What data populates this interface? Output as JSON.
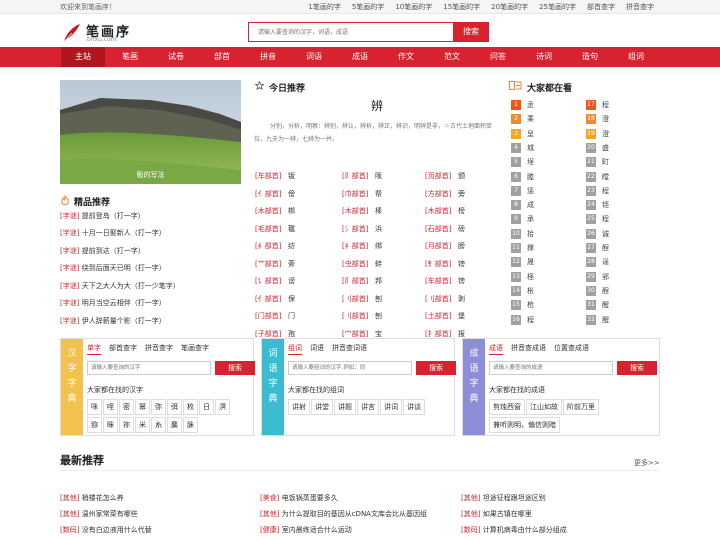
{
  "topbar": {
    "welcome": "欢迎来到笔画序！",
    "links": [
      "1笔画的字",
      "5笔画的字",
      "10笔画的字",
      "15笔画的字",
      "20笔画的字",
      "25笔画的字",
      "部首查字",
      "拼音查字"
    ]
  },
  "logo": {
    "name": "笔画序",
    "url": "bhxu.com"
  },
  "search": {
    "placeholder": "请输入要查询的汉字，词语，成语",
    "button": "搜索"
  },
  "nav": [
    "主站",
    "笔画",
    "试卷",
    "部首",
    "拼音",
    "词语",
    "成语",
    "作文",
    "范文",
    "问答",
    "诗词",
    "造句",
    "组词"
  ],
  "hero": {
    "caption": "彀的写法"
  },
  "picks": {
    "title": "精品推荐",
    "items": [
      {
        "tag": "[字谜]",
        "text": "提前登岛（打一字）"
      },
      {
        "tag": "[字谜]",
        "text": "十月一日娶新人（打一字）"
      },
      {
        "tag": "[字谜]",
        "text": "提前到达（打一字）"
      },
      {
        "tag": "[字谜]",
        "text": "绕到后面天已明（打一字）"
      },
      {
        "tag": "[字谜]",
        "text": "天下之大人为大（打一少笔字）"
      },
      {
        "tag": "[字谜]",
        "text": "明月当空云相伴（打一字）"
      },
      {
        "tag": "[字谜]",
        "text": "伊人辞薪量个影（打一字）"
      }
    ]
  },
  "today": {
    "title": "今日推荐",
    "word": "辨",
    "desc": "分别，分析，明察：辨别，辨认，辨析，辨正，辨识，明辨是非，＝古代土地面积单位，九夫为一辨，七辨为一并。"
  },
  "radicals": [
    [
      {
        "tag": "[车部首]",
        "ch": "钣"
      },
      {
        "tag": "[阝部首]",
        "ch": "阪"
      },
      {
        "tag": "[页部首]",
        "ch": "颁"
      }
    ],
    [
      {
        "tag": "[亻部首]",
        "ch": "傍"
      },
      {
        "tag": "[巾部首]",
        "ch": "帮"
      },
      {
        "tag": "[方部首]",
        "ch": "旁"
      }
    ],
    [
      {
        "tag": "[木部首]",
        "ch": "梆"
      },
      {
        "tag": "[木部首]",
        "ch": "棒"
      },
      {
        "tag": "[木部首]",
        "ch": "榜"
      }
    ],
    [
      {
        "tag": "[毛部首]",
        "ch": "毽"
      },
      {
        "tag": "[氵部首]",
        "ch": "浜"
      },
      {
        "tag": "[石部首]",
        "ch": "磅"
      }
    ],
    [
      {
        "tag": "[纟部首]",
        "ch": "纺"
      },
      {
        "tag": "[纟部首]",
        "ch": "绑"
      },
      {
        "tag": "[月部首]",
        "ch": "膀"
      }
    ],
    [
      {
        "tag": "[艹部首]",
        "ch": "蒡"
      },
      {
        "tag": "[虫部首]",
        "ch": "蚌"
      },
      {
        "tag": "[钅部首]",
        "ch": "镑"
      }
    ],
    [
      {
        "tag": "[讠部首]",
        "ch": "谤"
      },
      {
        "tag": "[阝部首]",
        "ch": "邦"
      },
      {
        "tag": "[车部首]",
        "ch": "镑"
      }
    ],
    [
      {
        "tag": "[亻部首]",
        "ch": "保"
      },
      {
        "tag": "[刂部首]",
        "ch": "刨"
      },
      {
        "tag": "[刂部首]",
        "ch": "剥"
      }
    ],
    [
      {
        "tag": "[门部首]",
        "ch": "门"
      },
      {
        "tag": "[刂部首]",
        "ch": "刨"
      },
      {
        "tag": "[土部首]",
        "ch": "堡"
      }
    ],
    [
      {
        "tag": "[子部首]",
        "ch": "孢"
      },
      {
        "tag": "[宀部首]",
        "ch": "宝"
      },
      {
        "tag": "[扌部首]",
        "ch": "报"
      }
    ]
  ],
  "hot": {
    "title": "大家都在看",
    "left": [
      "丞",
      "乘",
      "呈",
      "城",
      "埕",
      "塍",
      "惩",
      "成",
      "承",
      "拾",
      "撑",
      "晟",
      "柽",
      "枨",
      "枪",
      "程"
    ],
    "right": [
      "程",
      "澄",
      "澄",
      "盛",
      "町",
      "瞠",
      "程",
      "铚",
      "程",
      "诚",
      "酲",
      "逞",
      "郢",
      "酲",
      "醒",
      "醒"
    ],
    "colors": {
      "top1": "#e85a1c",
      "top2": "#f08a2c",
      "top3": "#f5a623",
      "rest": "#a0a0a0"
    }
  },
  "cards": [
    {
      "side": [
        "汉",
        "字",
        "字",
        "典"
      ],
      "color": "#f2c14e",
      "tabs": [
        "单字",
        "部首查字",
        "拼音查字",
        "笔画查字"
      ],
      "placeholder": "请输入要查询的汉字",
      "button": "搜索",
      "sub": "大家都在找的汉字",
      "chips": [
        "咪",
        "咥",
        "密",
        "幂",
        "弥",
        "弭",
        "枚",
        "日",
        "溟",
        "猕",
        "眯",
        "祢",
        "米",
        "糸",
        "麋",
        "脒"
      ]
    },
    {
      "side": [
        "词",
        "语",
        "字",
        "典"
      ],
      "color": "#3bbcd1",
      "tabs": [
        "组词",
        "词语",
        "拼音查词语"
      ],
      "placeholder": "请输入要组词的汉字,例如：同",
      "button": "搜索",
      "sub": "大家都在找的组词",
      "chips": [
        "讲射",
        "讲堂",
        "讲题",
        "讲言",
        "讲词",
        "讲谈"
      ]
    },
    {
      "side": [
        "成",
        "语",
        "字",
        "典"
      ],
      "color": "#8e8ed8",
      "tabs": [
        "成语",
        "拼音查成语",
        "位置查成语"
      ],
      "placeholder": "请输入要查询的成语",
      "button": "搜索",
      "sub": "大家都在找的成语",
      "chips": [
        "剪烛西窗",
        "江山如故",
        "阶前万里",
        "兼听则明，偏信则暗"
      ]
    }
  ],
  "latest": {
    "title": "最新推荐",
    "more": "更多>>",
    "items": [
      {
        "tag": "[其他]",
        "text": "梢楼花怎么养"
      },
      {
        "tag": "[美食]",
        "text": "电饭锅蒸蛋要多久"
      },
      {
        "tag": "[其他]",
        "text": "坦途征程跟坦途区别"
      },
      {
        "tag": "[其他]",
        "text": "温州家常菜有哪些"
      },
      {
        "tag": "[其他]",
        "text": "为什么提取目的基因从cDNA文库会比从基因组"
      },
      {
        "tag": "[其他]",
        "text": "如果古镇在哪里"
      },
      {
        "tag": "[数码]",
        "text": "没有白边液用什么代替"
      },
      {
        "tag": "[健康]",
        "text": "室内晨练适合什么运动"
      },
      {
        "tag": "[数码]",
        "text": "计算机病毒由什么部分组成"
      }
    ]
  }
}
